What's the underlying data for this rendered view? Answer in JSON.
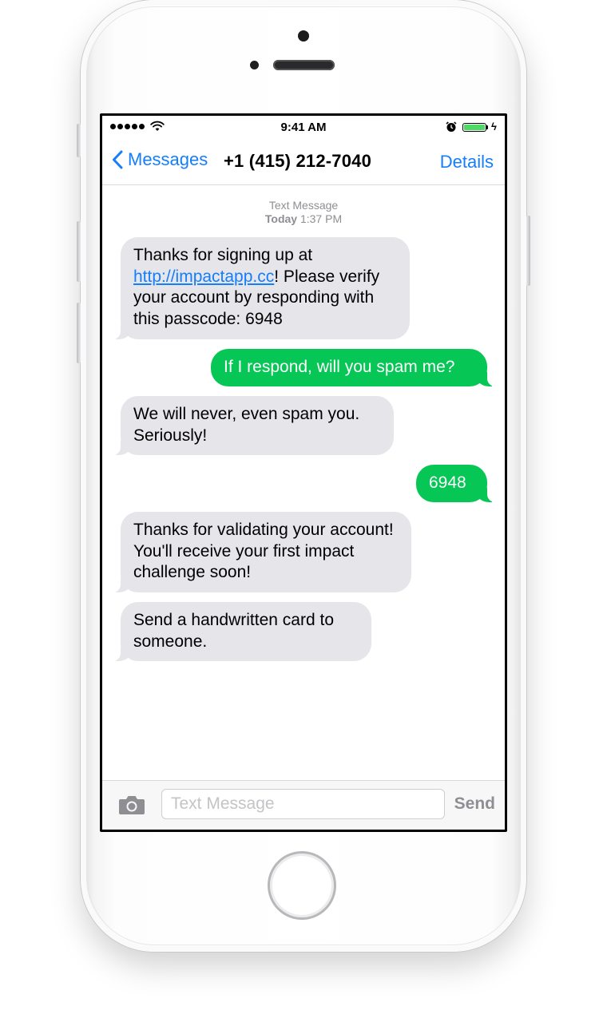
{
  "status_bar": {
    "time": "9:41 AM"
  },
  "nav": {
    "back_label": "Messages",
    "title": "+1 (415) 212-7040",
    "details_label": "Details"
  },
  "thread": {
    "header_type": "Text Message",
    "header_day": "Today",
    "header_time": "1:37 PM"
  },
  "messages": [
    {
      "direction": "incoming",
      "text_before": "Thanks for signing up at ",
      "link": "http://impactapp.cc",
      "text_after": "! Please verify your account by responding with this passcode: 6948"
    },
    {
      "direction": "outgoing",
      "text": "If I respond, will you spam me?"
    },
    {
      "direction": "incoming",
      "text": "We will never, even spam you. Seriously!"
    },
    {
      "direction": "outgoing",
      "text": "6948"
    },
    {
      "direction": "incoming",
      "text": "Thanks for validating your account! You'll receive your first impact challenge soon!"
    },
    {
      "direction": "incoming",
      "text": "Send a handwritten card to someone."
    }
  ],
  "composer": {
    "placeholder": "Text Message",
    "value": "",
    "send_label": "Send"
  },
  "icons": {
    "signal": "signal-dots-icon",
    "wifi": "wifi-icon",
    "alarm": "alarm-clock-icon",
    "battery": "battery-icon",
    "back": "chevron-left-icon",
    "camera": "camera-icon"
  },
  "colors": {
    "accent": "#147efb",
    "outgoing_bubble": "#06c655",
    "incoming_bubble": "#e5e5ea",
    "battery": "#4cd964"
  }
}
